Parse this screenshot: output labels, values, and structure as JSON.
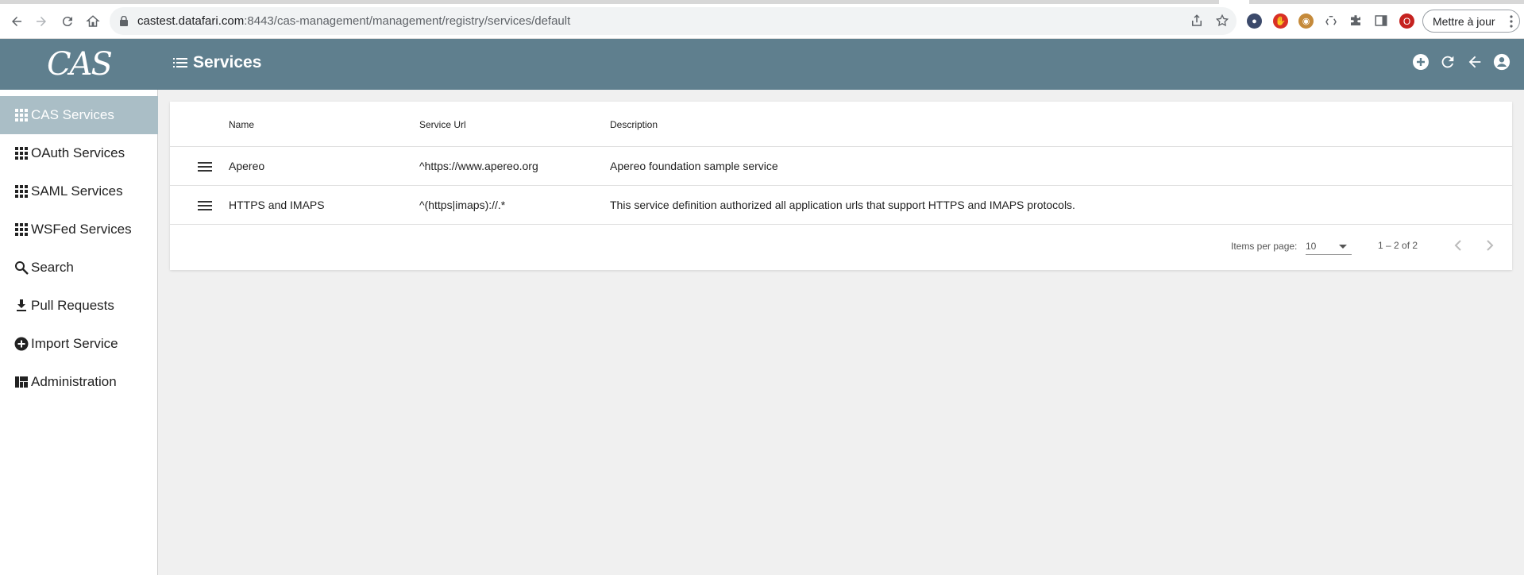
{
  "browser": {
    "url_host": "castest.datafari.com",
    "url_rest": ":8443/cas-management/management/registry/services/default",
    "update_label": "Mettre à jour",
    "profile_initial": "O"
  },
  "app": {
    "logo": "CAS",
    "page_title": "Services"
  },
  "sidebar": {
    "items": [
      {
        "label": "CAS Services",
        "icon": "apps-grid-icon",
        "active": true
      },
      {
        "label": "OAuth Services",
        "icon": "apps-grid-icon"
      },
      {
        "label": "SAML Services",
        "icon": "apps-grid-icon"
      },
      {
        "label": "WSFed Services",
        "icon": "apps-grid-icon"
      },
      {
        "label": "Search",
        "icon": "search-icon"
      },
      {
        "label": "Pull Requests",
        "icon": "download-icon"
      },
      {
        "label": "Import Service",
        "icon": "add-circle-icon"
      },
      {
        "label": "Administration",
        "icon": "dashboard-icon"
      }
    ]
  },
  "table": {
    "headers": {
      "name": "Name",
      "url": "Service Url",
      "description": "Description"
    },
    "rows": [
      {
        "name": "Apereo",
        "url": "^https://www.apereo.org",
        "description": "Apereo foundation sample service"
      },
      {
        "name": "HTTPS and IMAPS",
        "url": "^(https|imaps)://.*",
        "description": "This service definition authorized all application urls that support HTTPS and IMAPS protocols."
      }
    ]
  },
  "pager": {
    "items_label": "Items per page:",
    "page_size": "10",
    "range": "1 – 2 of 2"
  },
  "colors": {
    "header_bg": "#5f7f8e",
    "active_item_bg": "#aabec6"
  }
}
